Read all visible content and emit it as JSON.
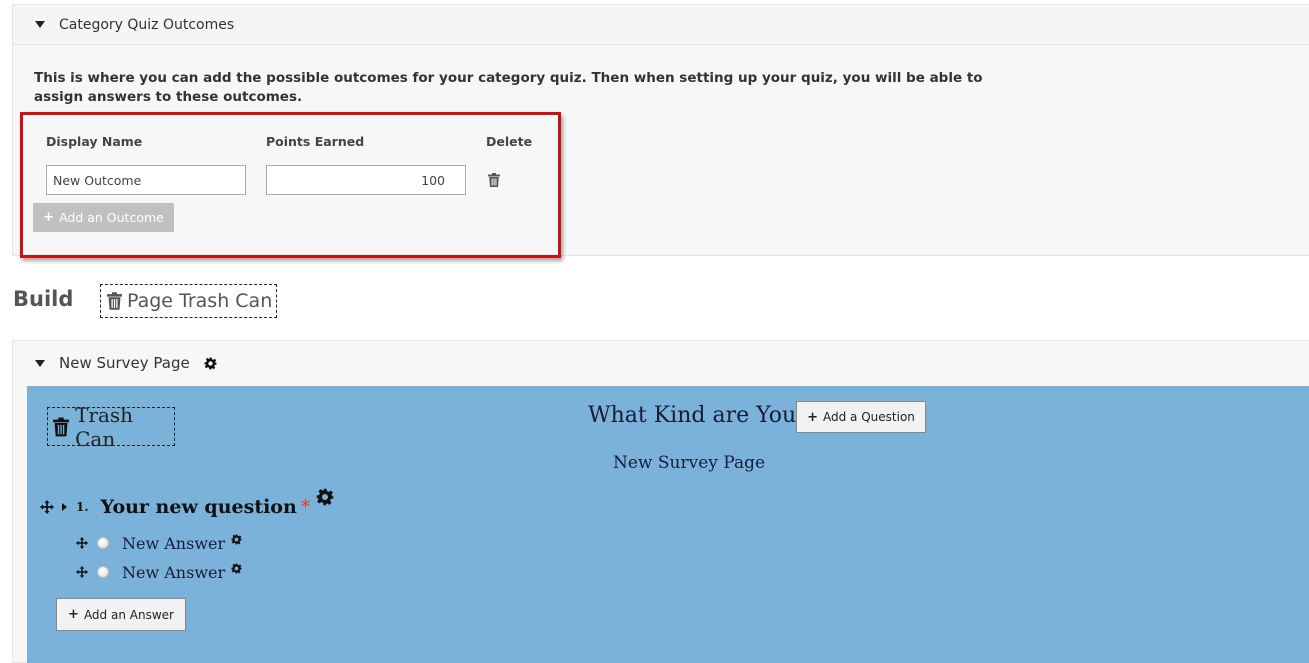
{
  "outcomes_panel": {
    "title": "Category Quiz Outcomes",
    "description": "This is where you can add the possible outcomes for your category quiz. Then when setting up your quiz, you will be able to assign answers to these outcomes.",
    "columns": {
      "display_name": "Display Name",
      "points_earned": "Points Earned",
      "delete": "Delete"
    },
    "rows": [
      {
        "display_name": "New Outcome",
        "points": "100"
      }
    ],
    "add_button_label": "Add an Outcome",
    "highlight_color": "#cc1111"
  },
  "build": {
    "title": "Build",
    "page_trash_label": "Page Trash Can"
  },
  "survey_page": {
    "header_title": "New Survey Page",
    "trash_label": "Trash Can",
    "survey_title": "What Kind are You",
    "add_question_label": "Add a Question",
    "page_name": "New Survey Page",
    "canvas_color": "#7ab2d9",
    "question": {
      "number": "1.",
      "text": "Your new question",
      "required_mark": "*",
      "answers": [
        {
          "text": "New Answer"
        },
        {
          "text": "New Answer"
        }
      ]
    },
    "add_answer_label": "Add an Answer"
  },
  "icons": [
    "caret-down-icon",
    "trash-icon",
    "gear-icon",
    "move-icon",
    "caret-right-icon",
    "plus-icon"
  ]
}
